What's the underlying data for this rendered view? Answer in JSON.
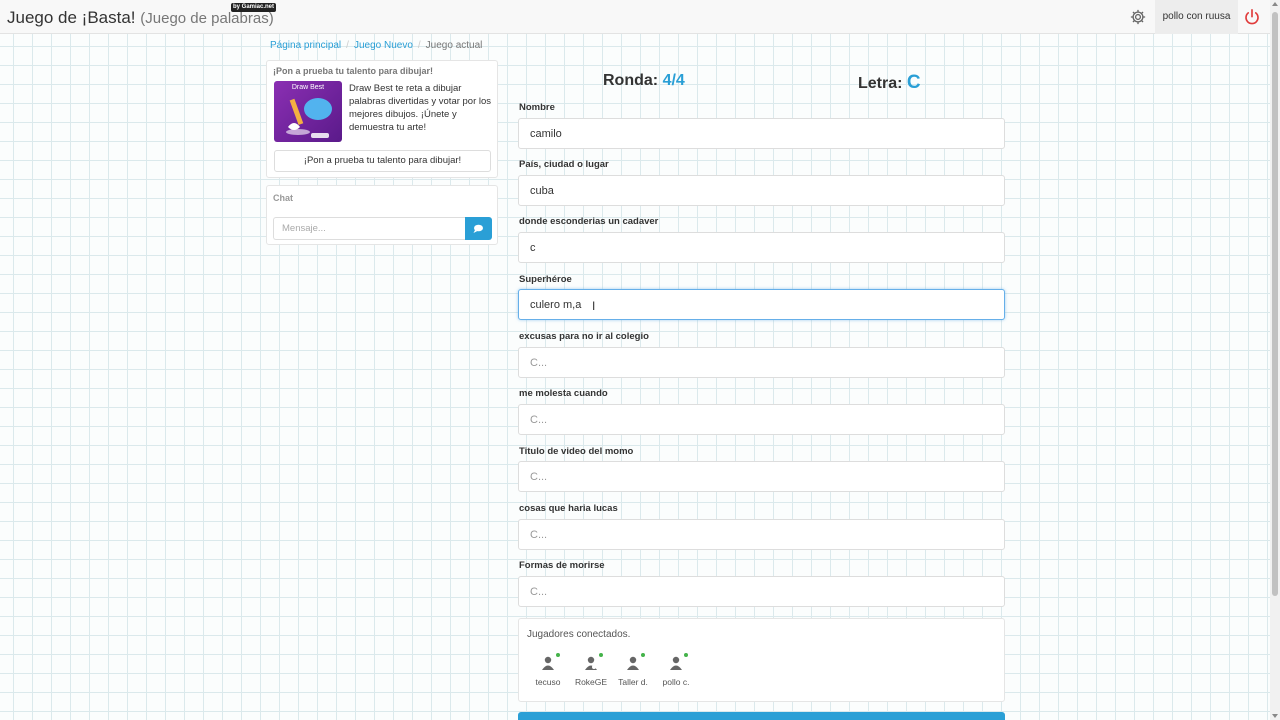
{
  "header": {
    "title": "Juego de ¡Basta!",
    "subtitle": "(Juego de palabras)",
    "badge": "by Gamiac.net",
    "username": "pollo con ruusa"
  },
  "breadcrumb": {
    "home": "Página principal",
    "new_game": "Juego Nuevo",
    "current": "Juego actual"
  },
  "ad": {
    "title": "¡Pon a prueba tu talento para dibujar!",
    "image_label": "Draw Best",
    "text": "Draw Best te reta a dibujar palabras divertidas y votar por los mejores dibujos. ¡Únete y demuestra tu arte!",
    "button": "¡Pon a prueba tu talento para dibujar!"
  },
  "chat": {
    "title": "Chat",
    "placeholder": "Mensaje..."
  },
  "game": {
    "round_label": "Ronda:",
    "round_value": "4/4",
    "letter_label": "Letra:",
    "letter_value": "C"
  },
  "fields": [
    {
      "label": "Nombre",
      "value": "camilo",
      "placeholder": ""
    },
    {
      "label": "País, ciudad o lugar",
      "value": "cuba",
      "placeholder": ""
    },
    {
      "label": "donde esconderias un cadaver",
      "value": "c",
      "placeholder": ""
    },
    {
      "label": "Superhéroe",
      "value": "culero m,a",
      "placeholder": ""
    },
    {
      "label": "excusas para no ir al colegio",
      "value": "",
      "placeholder": "C..."
    },
    {
      "label": "me molesta cuando",
      "value": "",
      "placeholder": "C..."
    },
    {
      "label": "Titulo de video del momo",
      "value": "",
      "placeholder": "C..."
    },
    {
      "label": "cosas que haria lucas",
      "value": "",
      "placeholder": "C..."
    },
    {
      "label": "Formas de morirse",
      "value": "",
      "placeholder": "C..."
    }
  ],
  "players": {
    "title": "Jugadores conectados.",
    "list": [
      {
        "name": "tecuso"
      },
      {
        "name": "RokeGE"
      },
      {
        "name": "Taller d."
      },
      {
        "name": "pollo c."
      }
    ]
  },
  "colors": {
    "accent": "#2a9fd6",
    "online": "#44b34a",
    "power": "#e03b3b"
  }
}
